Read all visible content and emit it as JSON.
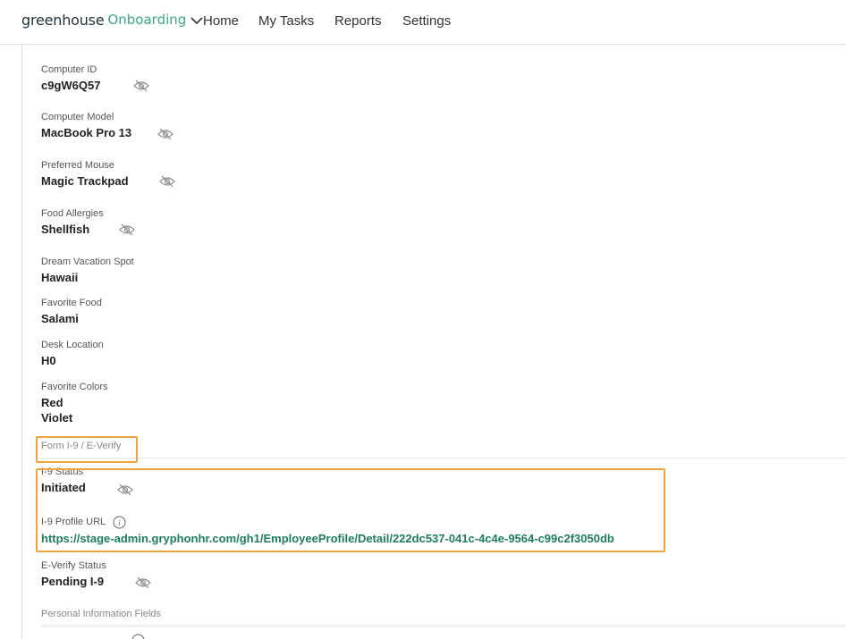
{
  "nav": {
    "brand_main": "greenhouse",
    "brand_sub": "Onboarding",
    "links": [
      "Home",
      "My Tasks",
      "Reports",
      "Settings"
    ]
  },
  "fields": [
    {
      "label": "Computer ID",
      "value": "c9gW6Q57"
    },
    {
      "label": "Computer Model",
      "value": "MacBook Pro 13"
    },
    {
      "label": "Preferred Mouse",
      "value": "Magic Trackpad"
    },
    {
      "label": "Food Allergies",
      "value": "Shellfish"
    },
    {
      "label": "Dream Vacation Spot",
      "value": "Hawaii"
    },
    {
      "label": "Favorite Food",
      "value": "Salami"
    },
    {
      "label": "Desk Location",
      "value": "H0"
    },
    {
      "label": "Favorite Colors",
      "values": [
        "Red",
        "Violet"
      ]
    }
  ],
  "sections": {
    "i9": {
      "title": "Form I-9 / E-Verify",
      "status_label": "I-9 Status",
      "status_value": "Initiated",
      "url_label": "I-9 Profile URL",
      "url_value": "https://stage-admin.gryphonhr.com/gh1/EmployeeProfile/Detail/222dc537-041c-4c4e-9564-c99c2f3050db",
      "everify_label": "E-Verify Status",
      "everify_value": "Pending I-9"
    },
    "personal": {
      "title": "Personal Information Fields"
    }
  },
  "colors": {
    "brand_green": "#3ba886",
    "link_green": "#1d7e5e",
    "highlight": "#f0a33a"
  },
  "icons": {
    "hidden": "eye-slash-icon",
    "info": "info-icon",
    "chevron": "chevron-down-icon"
  }
}
